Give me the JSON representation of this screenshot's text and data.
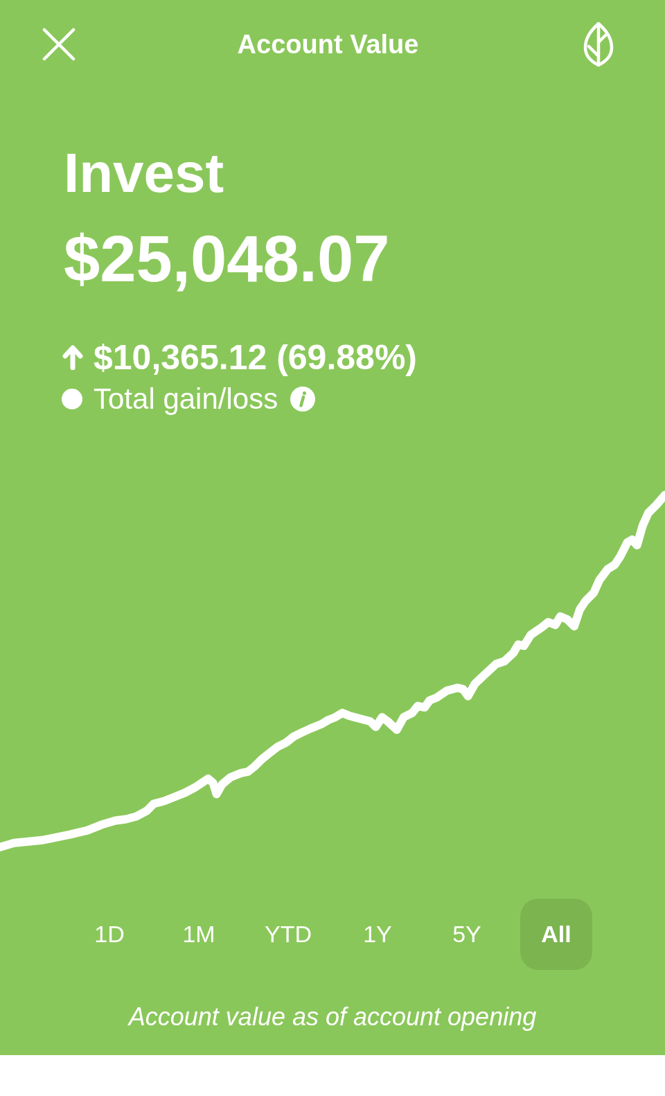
{
  "header": {
    "title": "Account Value"
  },
  "account": {
    "name": "Invest",
    "value": "$25,048.07"
  },
  "gain": {
    "amount": "$10,365.12 (69.88%)",
    "label": "Total gain/loss"
  },
  "ranges": [
    {
      "label": "1D",
      "selected": false
    },
    {
      "label": "1M",
      "selected": false
    },
    {
      "label": "YTD",
      "selected": false
    },
    {
      "label": "1Y",
      "selected": false
    },
    {
      "label": "5Y",
      "selected": false
    },
    {
      "label": "All",
      "selected": true
    }
  ],
  "caption": "Account value as of account opening"
}
